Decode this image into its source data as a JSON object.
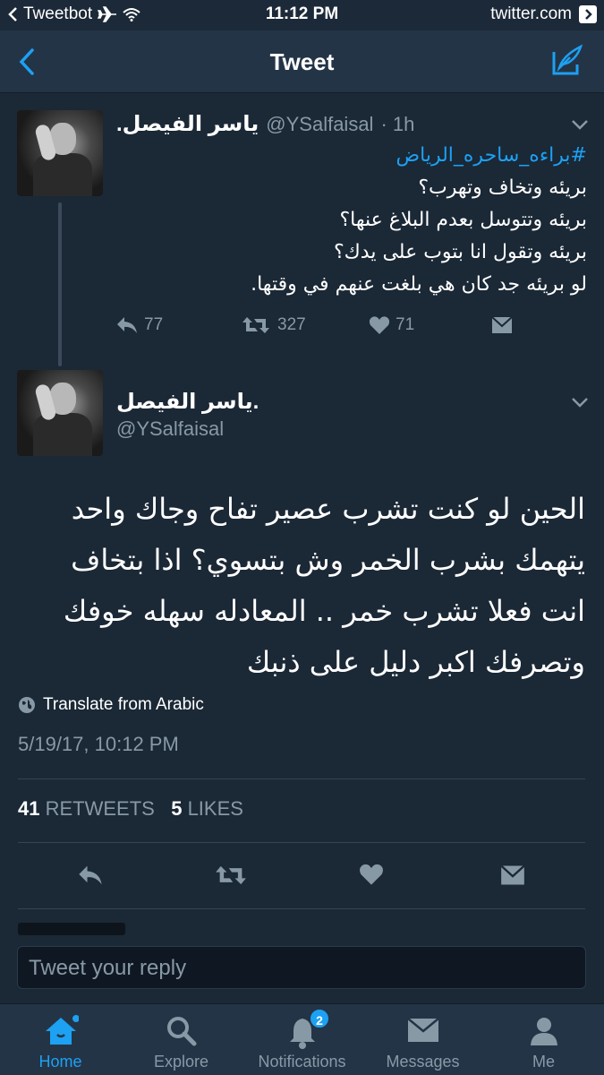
{
  "status_bar": {
    "back_app": "Tweetbot",
    "time": "11:12 PM",
    "url": "twitter.com"
  },
  "navbar": {
    "title": "Tweet"
  },
  "parent_tweet": {
    "name": "ياسر الفيصل.",
    "handle": "@YSalfaisal",
    "age": "· 1h",
    "hashtag": "#براءه_ساحره_الرياض",
    "lines": [
      "بريئه وتخاف وتهرب؟",
      "بريئه وتتوسل بعدم البلاغ عنها؟",
      "بريئه وتقول انا بتوب على يدك؟",
      "لو بريئه جد كان هي بلغت عنهم في وقتها."
    ],
    "replies": "77",
    "retweets": "327",
    "likes": "71"
  },
  "main_tweet": {
    "name": "ياسر الفيصل.",
    "handle": "@YSalfaisal",
    "text": "الحين لو كنت تشرب عصير تفاح وجاك واحد يتهمك بشرب الخمر وش بتسوي؟ اذا بتخاف انت فعلا تشرب خمر .. المعادله سهله خوفك وتصرفك اكبر دليل على ذنبك",
    "translate_label": "Translate from Arabic",
    "timestamp": "5/19/17, 10:12 PM",
    "retweet_count": "41",
    "retweet_label": "RETWEETS",
    "like_count": "5",
    "like_label": "LIKES"
  },
  "reply_box": {
    "placeholder": "Tweet your reply"
  },
  "tabbar": {
    "items": [
      {
        "label": "Home",
        "icon": "home-icon"
      },
      {
        "label": "Explore",
        "icon": "search-icon"
      },
      {
        "label": "Notifications",
        "icon": "bell-icon",
        "badge": "2"
      },
      {
        "label": "Messages",
        "icon": "envelope-icon"
      },
      {
        "label": "Me",
        "icon": "person-icon"
      }
    ]
  },
  "colors": {
    "background": "#1b2836",
    "bar": "#243447",
    "accent": "#1da1f2",
    "muted": "#8899a6"
  }
}
